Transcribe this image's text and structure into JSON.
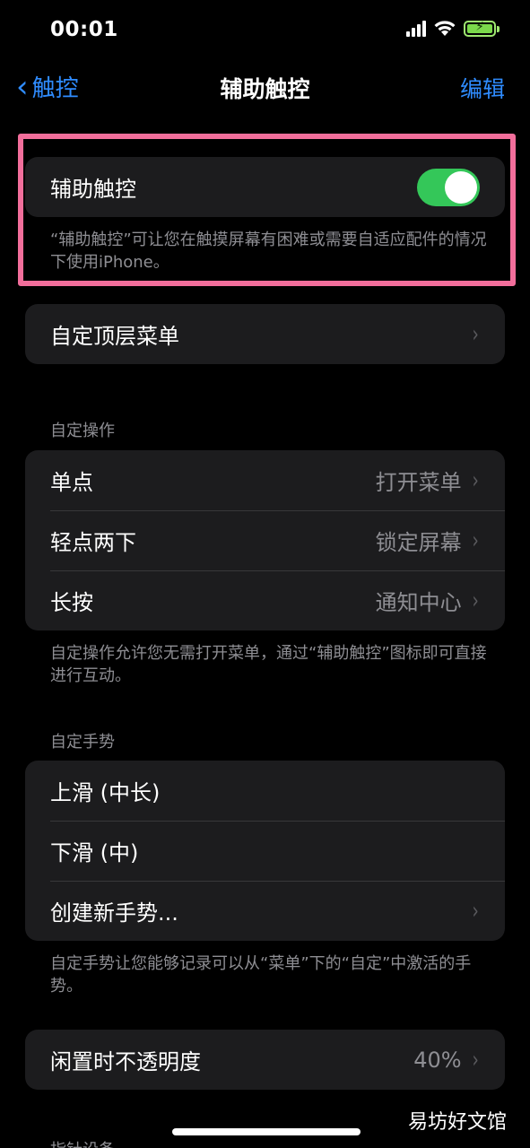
{
  "status_bar": {
    "time": "00:01"
  },
  "nav": {
    "back_label": "触控",
    "title": "辅助触控",
    "edit_label": "编辑"
  },
  "assistive_touch": {
    "label": "辅助触控",
    "toggle_on": true,
    "footer": "“辅助触控”可让您在触摸屏幕有困难或需要自适应配件的情况下使用iPhone。"
  },
  "custom_top_menu": {
    "label": "自定顶层菜单"
  },
  "custom_actions": {
    "header": "自定操作",
    "rows": [
      {
        "label": "单点",
        "value": "打开菜单"
      },
      {
        "label": "轻点两下",
        "value": "锁定屏幕"
      },
      {
        "label": "长按",
        "value": "通知中心"
      }
    ],
    "footer": "自定操作允许您无需打开菜单，通过“辅助触控”图标即可直接进行互动。"
  },
  "custom_gestures": {
    "header": "自定手势",
    "rows": [
      {
        "label": "上滑 (中长)"
      },
      {
        "label": "下滑 (中)"
      },
      {
        "label": "创建新手势..."
      }
    ],
    "footer": "自定手势让您能够记录可以从“菜单”下的“自定”中激活的手势。"
  },
  "idle_opacity": {
    "label": "闲置时不透明度",
    "value": "40%"
  },
  "next_header": "指针设备",
  "watermark": "易坊好文馆",
  "colors": {
    "accent": "#2f8cff",
    "toggle_on": "#34c759",
    "highlight": "#f26e9b"
  }
}
